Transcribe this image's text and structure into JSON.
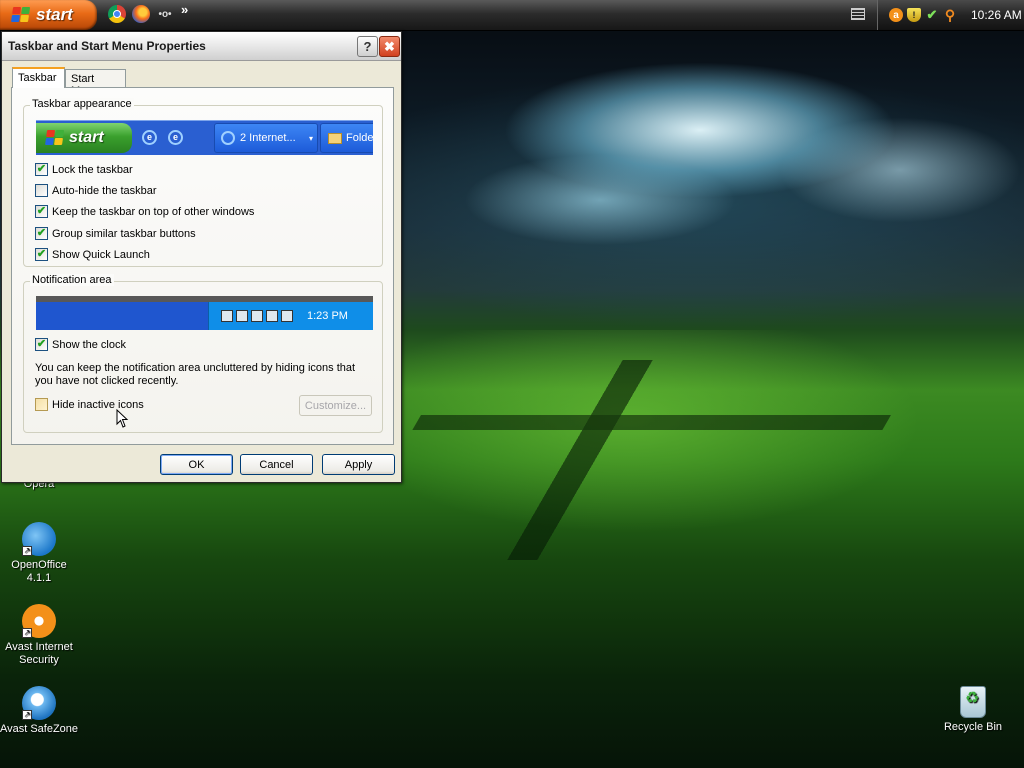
{
  "taskbar": {
    "start_label": "start",
    "quick_launch": [
      "chrome-icon",
      "firefox-icon",
      "opera-mini-icon"
    ],
    "opera_mini_glyph": "•o•",
    "chevron": "»",
    "tray": {
      "avast_glyph": "a",
      "shield_glyph": "!",
      "net_glyph": "✔",
      "search_glyph": "⚲",
      "clock": "10:26 AM"
    }
  },
  "desktop": {
    "icons": [
      {
        "name": "Opera"
      },
      {
        "name": "OpenOffice 4.1.1"
      },
      {
        "name": "Avast Internet Security"
      },
      {
        "name": "Avast SafeZone"
      },
      {
        "name": "Recycle Bin"
      }
    ]
  },
  "dialog": {
    "title": "Taskbar and Start Menu Properties",
    "help_glyph": "?",
    "close_glyph": "✖",
    "tabs": [
      {
        "label": "Taskbar",
        "selected": true
      },
      {
        "label": "Start Menu",
        "selected": false
      }
    ],
    "appearance": {
      "group_label": "Taskbar appearance",
      "preview": {
        "start_label": "start",
        "ie_glyph": "e",
        "internet_button": "2 Internet...",
        "caret": "▾",
        "folder_button": "Folde"
      },
      "options": [
        {
          "label": "Lock the taskbar",
          "checked": true
        },
        {
          "label": "Auto-hide the taskbar",
          "checked": false
        },
        {
          "label": "Keep the taskbar on top of other windows",
          "checked": true
        },
        {
          "label": "Group similar taskbar buttons",
          "checked": true
        },
        {
          "label": "Show Quick Launch",
          "checked": true
        }
      ]
    },
    "notification": {
      "group_label": "Notification area",
      "preview_clock": "1:23 PM",
      "show_clock": {
        "label": "Show the clock",
        "checked": true
      },
      "description": "You can keep the notification area uncluttered by hiding icons that you have not clicked recently.",
      "hide_inactive": {
        "label": "Hide inactive icons",
        "checked": false
      },
      "customize_label": "Customize..."
    },
    "buttons": {
      "ok": "OK",
      "cancel": "Cancel",
      "apply": "Apply"
    }
  },
  "check_glyph": "✔",
  "colors": {
    "start_orange": "#e86a16",
    "xp_blue": "#2a5fd1",
    "dialog_face": "#ece9d8",
    "check_green": "#21a121",
    "close_red": "#d1401f"
  }
}
